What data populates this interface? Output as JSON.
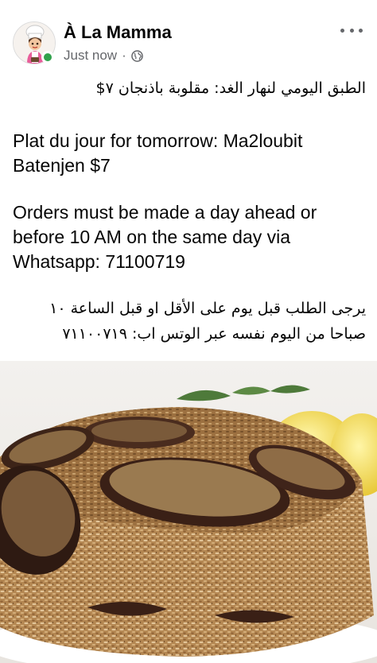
{
  "post": {
    "page_name": "À La Mamma",
    "timestamp": "Just now",
    "separator": "·",
    "privacy_icon": "globe-icon",
    "more_icon": "more-options-icon",
    "online_status_color": "#31a24c"
  },
  "text": {
    "arabic_line1": "الطبق اليومي لنهار الغد: مقلوبة باذنجان ٧$",
    "plat_du_jour": "Plat du jour for tomorrow: Ma2loubit Batenjen $7",
    "orders": "Orders must be made a day ahead or before 10 AM  on the same day via Whatsapp: 71100719",
    "arabic_orders": "يرجى الطلب قبل يوم على الأقل او قبل الساعة ١٠ صباحا من اليوم نفسه عبر الوتس اب: ٧١١٠٠٧١٩"
  },
  "image": {
    "subject": "maqluba-eggplant-dish-photo"
  }
}
